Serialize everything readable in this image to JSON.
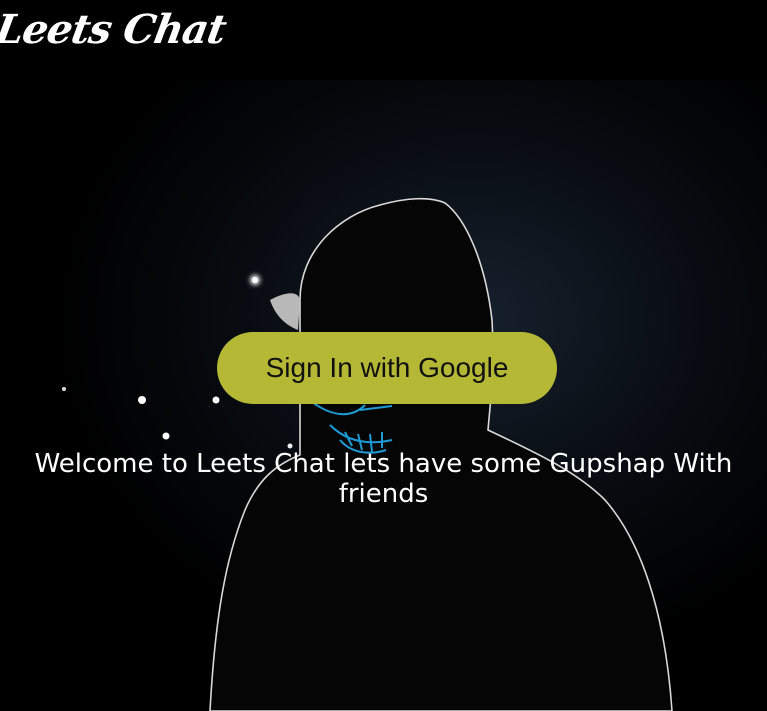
{
  "app": {
    "logo_text": "Leets Chat"
  },
  "auth": {
    "signin_label": "Sign In with Google"
  },
  "hero": {
    "welcome_text": "Welcome to Leets Chat lets have some Gupshap With friends"
  },
  "colors": {
    "background": "#000000",
    "button": "#b5b835",
    "text": "#ffffff",
    "mask_glow": "#1e9bd7"
  }
}
